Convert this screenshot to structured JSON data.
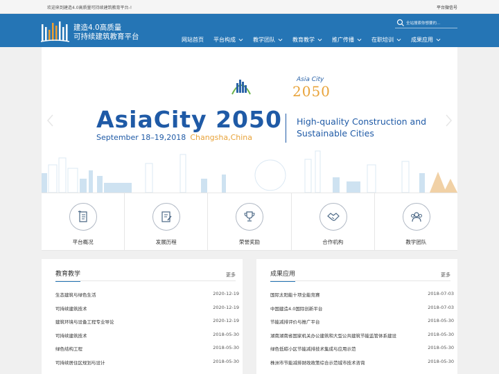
{
  "topbar": {
    "welcome": "欢迎来到建造4.0高质量可持续建筑教育平台-!",
    "wechat": "平台微信号"
  },
  "header": {
    "logo_line1": "建造4.0高质量",
    "logo_line2": "可持续建筑教育平台",
    "search_placeholder": "全站搜索你想要的...",
    "nav": [
      {
        "label": "网站首页",
        "dropdown": false
      },
      {
        "label": "平台构成",
        "dropdown": true
      },
      {
        "label": "教学团队",
        "dropdown": true
      },
      {
        "label": "教育教学",
        "dropdown": true
      },
      {
        "label": "推广传播",
        "dropdown": true
      },
      {
        "label": "在职培训",
        "dropdown": true
      },
      {
        "label": "成果应用",
        "dropdown": true
      }
    ]
  },
  "banner": {
    "logo_text": "Asia City",
    "logo_year": "2050",
    "title": "AsiaCity 2050",
    "date_prefix": "September ",
    "date_days": "18–19,2018",
    "date_city": "Changsha,China",
    "tagline_line1": "High-quality Construction and",
    "tagline_line2": "Sustainable Cities"
  },
  "features": [
    {
      "label": "平台概况",
      "icon": "scroll-icon"
    },
    {
      "label": "发展历程",
      "icon": "document-edit-icon"
    },
    {
      "label": "荣誉奖励",
      "icon": "trophy-icon"
    },
    {
      "label": "合作机构",
      "icon": "handshake-icon"
    },
    {
      "label": "教学团队",
      "icon": "team-icon"
    }
  ],
  "education": {
    "title": "教育教学",
    "more": "更多",
    "items": [
      {
        "title": "生态建筑与绿色生活",
        "date": "2020-12-19"
      },
      {
        "title": "可持续建筑技术",
        "date": "2020-12-19"
      },
      {
        "title": "建筑环境与设备工程专业导论",
        "date": "2020-12-19"
      },
      {
        "title": "可持续建筑技术",
        "date": "2018-05-30"
      },
      {
        "title": "绿色结构工程",
        "date": "2018-05-30"
      },
      {
        "title": "可持续居住区规划与设计",
        "date": "2018-05-30"
      }
    ]
  },
  "results": {
    "title": "成果应用",
    "more": "更多",
    "items": [
      {
        "title": "国际太阳能十项全能竞赛",
        "date": "2018-07-03"
      },
      {
        "title": "中国建造4.0国际创新平台",
        "date": "2018-07-03"
      },
      {
        "title": "节能减排评价与推广平台",
        "date": "2018-05-30"
      },
      {
        "title": "湖南湖南省国家机关办公建筑和大型公共建筑节能监管体系建设",
        "date": "2018-05-30"
      },
      {
        "title": "绿色低碳小区节能减排技术集成与应用示范",
        "date": "2018-05-30"
      },
      {
        "title": "株洲市节能减排财政政策综合示范城市技术咨询",
        "date": "2018-05-30"
      }
    ]
  }
}
